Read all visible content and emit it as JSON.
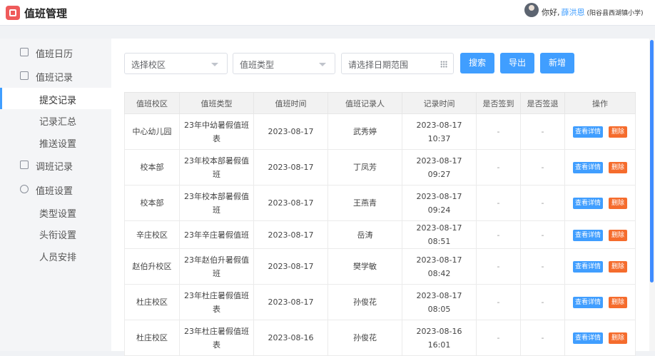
{
  "header": {
    "app_title": "值班管理",
    "greeting": "你好,",
    "user_name": "薛洪恩",
    "school": "(阳谷县西湖镇小学)"
  },
  "sidebar": {
    "groups": [
      {
        "label": "值班日历",
        "icon": "calendar-icon"
      },
      {
        "label": "值班记录",
        "icon": "record-icon"
      },
      {
        "label": "调班记录",
        "icon": "swap-icon"
      },
      {
        "label": "值班设置",
        "icon": "gear-icon"
      }
    ],
    "record_items": [
      "提交记录",
      "记录汇总",
      "推送设置"
    ],
    "settings_items": [
      "类型设置",
      "头衔设置",
      "人员安排"
    ],
    "active": "提交记录"
  },
  "filters": {
    "campus_placeholder": "选择校区",
    "type_placeholder": "值班类型",
    "date_placeholder": "请选择日期范围"
  },
  "buttons": {
    "search": "搜索",
    "export": "导出",
    "add": "新增"
  },
  "table": {
    "columns": [
      "值班校区",
      "值班类型",
      "值班时间",
      "值班记录人",
      "记录时间",
      "是否签到",
      "是否签退",
      "操作"
    ],
    "view_label": "查看详情",
    "delete_label": "删除",
    "rows": [
      {
        "campus": "中心幼儿园",
        "type": "23年中幼暑假值班表",
        "date": "2023-08-17",
        "recorder": "武秀婷",
        "record_time": "2023-08-17 10:37",
        "signin": "-",
        "signout": "-"
      },
      {
        "campus": "校本部",
        "type": "23年校本部暑假值班",
        "date": "2023-08-17",
        "recorder": "丁凤芳",
        "record_time": "2023-08-17 09:27",
        "signin": "-",
        "signout": "-"
      },
      {
        "campus": "校本部",
        "type": "23年校本部暑假值班",
        "date": "2023-08-17",
        "recorder": "王燕青",
        "record_time": "2023-08-17 09:24",
        "signin": "-",
        "signout": "-"
      },
      {
        "campus": "辛庄校区",
        "type": "23年辛庄暑假值班",
        "date": "2023-08-17",
        "recorder": "岳涛",
        "record_time": "2023-08-17 08:51",
        "signin": "-",
        "signout": "-"
      },
      {
        "campus": "赵伯升校区",
        "type": "23年赵伯升暑假值班",
        "date": "2023-08-17",
        "recorder": "樊学敏",
        "record_time": "2023-08-17 08:42",
        "signin": "-",
        "signout": "-"
      },
      {
        "campus": "杜庄校区",
        "type": "23年杜庄暑假值班表",
        "date": "2023-08-17",
        "recorder": "孙俊花",
        "record_time": "2023-08-17 08:05",
        "signin": "-",
        "signout": "-"
      },
      {
        "campus": "杜庄校区",
        "type": "23年杜庄暑假值班表",
        "date": "2023-08-16",
        "recorder": "孙俊花",
        "record_time": "2023-08-16 16:01",
        "signin": "-",
        "signout": "-"
      }
    ]
  },
  "colors": {
    "primary": "#409eff",
    "danger": "#f56c2d",
    "logo": "#ef5b5b"
  }
}
